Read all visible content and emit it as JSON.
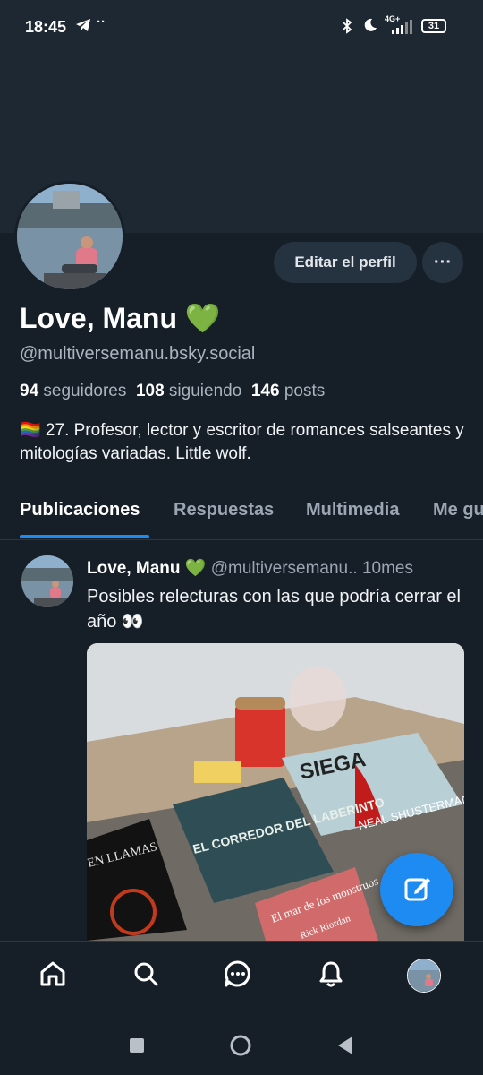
{
  "status_bar": {
    "time": "18:45",
    "network": "4G+",
    "battery": "31"
  },
  "profile": {
    "display_name": "Love, Manu 💚",
    "handle": "@multiversemanu.bsky.social",
    "followers_count": "94",
    "followers_label": "seguidores",
    "following_count": "108",
    "following_label": "siguiendo",
    "posts_count": "146",
    "posts_label": "posts",
    "bio": "🏳️‍🌈 27. Profesor, lector y escritor de romances salseantes y mitologías variadas. Little wolf.",
    "edit_button": "Editar el perfil",
    "more_button": "···"
  },
  "tabs": [
    {
      "label": "Publicaciones",
      "active": true
    },
    {
      "label": "Respuestas",
      "active": false
    },
    {
      "label": "Multimedia",
      "active": false
    },
    {
      "label": "Me gu",
      "active": false
    }
  ],
  "post": {
    "author": "Love, Manu 💚",
    "handle": "@multiversemanu..",
    "time": "10mes",
    "text": "Posibles relecturas con las que podría cerrar el año 👀",
    "image_book_titles": [
      "SIEGA",
      "NEAL SHUSTERMAN",
      "EL CORREDOR DEL LABERINTO",
      "EN LLAMAS",
      "El mar de los monstruos",
      "Rick Riordan"
    ]
  },
  "colors": {
    "background": "#161e27",
    "accent": "#1d8bf1",
    "banner": "#1e2833"
  },
  "nav": [
    "home-icon",
    "search-icon",
    "chat-icon",
    "bell-icon",
    "avatar"
  ]
}
